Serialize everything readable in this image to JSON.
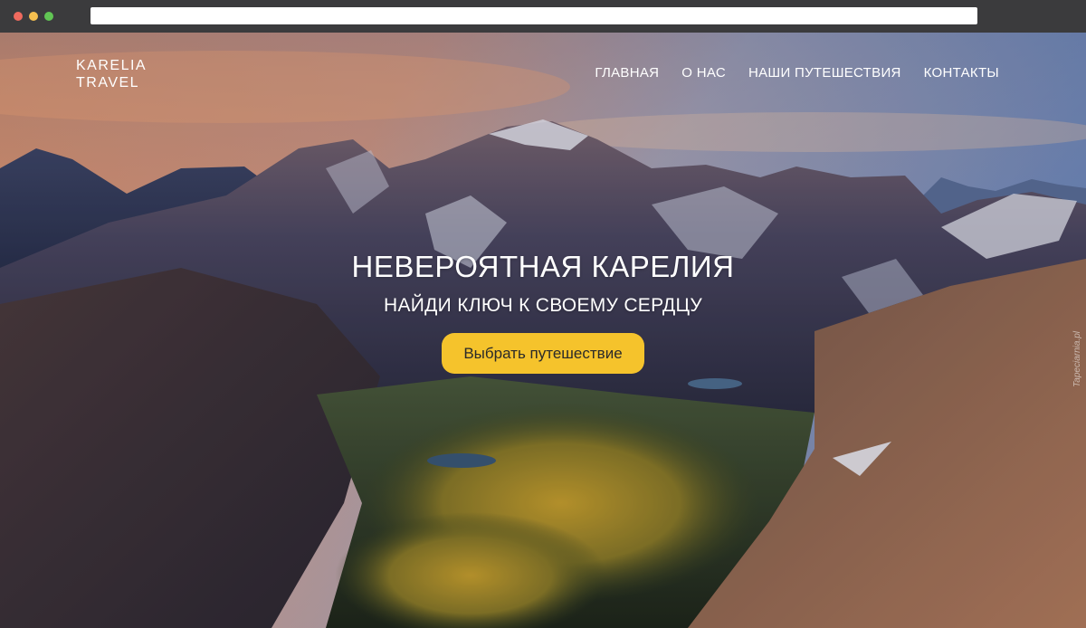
{
  "brand": {
    "line1": "KARELIA",
    "line2": "TRAVEL"
  },
  "nav": {
    "items": [
      {
        "label": "ГЛАВНАЯ"
      },
      {
        "label": "О НАС"
      },
      {
        "label": "НАШИ ПУТЕШЕСТВИЯ"
      },
      {
        "label": "КОНТАКТЫ"
      }
    ]
  },
  "hero": {
    "title": "НЕВЕРОЯТНАЯ КАРЕЛИЯ",
    "subtitle": "НАЙДИ КЛЮЧ К СВОЕМУ СЕРДЦУ",
    "cta_label": "Выбрать путешествие"
  },
  "watermark": "Tapeciarnia.pl",
  "colors": {
    "accent": "#f5c32c",
    "text": "#ffffff",
    "chrome": "#3b3b3d"
  }
}
